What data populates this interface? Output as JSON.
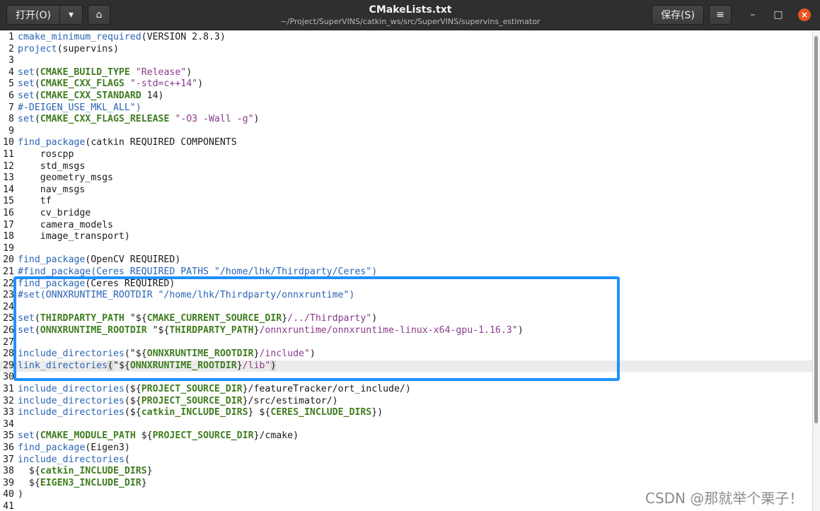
{
  "toolbar": {
    "open_label": "打开(O)",
    "open_menu_icon": "▾",
    "pin_icon": "⌂",
    "save_label": "保存(S)",
    "menu_icon": "≡",
    "minimize_icon": "–",
    "maximize_icon": "□",
    "close_icon": "×"
  },
  "window": {
    "title": "CMakeLists.txt",
    "path": "~/Project/SuperVINS/catkin_ws/src/SuperVINS/supervins_estimator"
  },
  "editor": {
    "current_line": 29,
    "lines": [
      {
        "n": "1",
        "html": "<span class=\"kw\">cmake_minimum_required</span>(VERSION 2.8.3)"
      },
      {
        "n": "2",
        "html": "<span class=\"kw\">project</span>(supervins)"
      },
      {
        "n": "3",
        "html": ""
      },
      {
        "n": "4",
        "html": "<span class=\"kw\">set</span>(<span class=\"var\">CMAKE_BUILD_TYPE</span> <span class=\"str\">\"Release\"</span>)"
      },
      {
        "n": "5",
        "html": "<span class=\"kw\">set</span>(<span class=\"var\">CMAKE_CXX_FLAGS</span> <span class=\"str\">\"-std=c++14\"</span>)"
      },
      {
        "n": "6",
        "html": "<span class=\"kw\">set</span>(<span class=\"var\">CMAKE_CXX_STANDARD</span> 14)"
      },
      {
        "n": "7",
        "html": "<span class=\"cm\">#-DEIGEN_USE_MKL_ALL\")</span>"
      },
      {
        "n": "8",
        "html": "<span class=\"kw\">set</span>(<span class=\"var\">CMAKE_CXX_FLAGS_RELEASE</span> <span class=\"str\">\"-O3 -Wall -g\"</span>)"
      },
      {
        "n": "9",
        "html": ""
      },
      {
        "n": "10",
        "html": "<span class=\"kw\">find_package</span>(catkin REQUIRED COMPONENTS"
      },
      {
        "n": "11",
        "html": "    roscpp"
      },
      {
        "n": "12",
        "html": "    std_msgs"
      },
      {
        "n": "13",
        "html": "    geometry_msgs"
      },
      {
        "n": "14",
        "html": "    nav_msgs"
      },
      {
        "n": "15",
        "html": "    tf"
      },
      {
        "n": "16",
        "html": "    cv_bridge"
      },
      {
        "n": "17",
        "html": "    camera_models"
      },
      {
        "n": "18",
        "html": "    image_transport)"
      },
      {
        "n": "19",
        "html": ""
      },
      {
        "n": "20",
        "html": "<span class=\"kw\">find_package</span>(OpenCV REQUIRED)"
      },
      {
        "n": "21",
        "html": "<span class=\"cm\">#find_package(Ceres REQUIRED PATHS \"/home/lhk/Thirdparty/Ceres\")</span>"
      },
      {
        "n": "22",
        "html": "<span class=\"kw\">find_package</span>(Ceres REQUIRED)"
      },
      {
        "n": "23",
        "html": "<span class=\"cm\">#set(ONNXRUNTIME_ROOTDIR \"/home/lhk/Thirdparty/onnxruntime\")</span>"
      },
      {
        "n": "24",
        "html": ""
      },
      {
        "n": "25",
        "html": "<span class=\"kw\">set</span>(<span class=\"var\">THIRDPARTY_PATH</span> \"${<span class=\"var\">CMAKE_CURRENT_SOURCE_DIR</span>}<span class=\"str\">/../Thirdparty\"</span>)"
      },
      {
        "n": "26",
        "html": "<span class=\"kw\">set</span>(<span class=\"var\">ONNXRUNTIME_ROOTDIR</span> \"${<span class=\"var\">THIRDPARTY_PATH</span>}<span class=\"str\">/onnxruntime/onnxruntime-linux-x64-gpu-1.16.3\"</span>)"
      },
      {
        "n": "27",
        "html": ""
      },
      {
        "n": "28",
        "html": "<span class=\"kw\">include_directories</span>(\"${<span class=\"var\">ONNXRUNTIME_ROOTDIR</span>}<span class=\"str\">/include\"</span>)"
      },
      {
        "n": "29",
        "html": "<span class=\"kw\">link_directories</span><span class=\"sel\">(</span>\"${<span class=\"var\">ONNXRUNTIME_ROOTDIR</span>}<span class=\"str\">/lib\"</span><span class=\"sel\">)</span>"
      },
      {
        "n": "30",
        "html": ""
      },
      {
        "n": "31",
        "html": "<span class=\"kw\">include_directories</span>(${<span class=\"var\">PROJECT_SOURCE_DIR</span>}/featureTracker/ort_include/)"
      },
      {
        "n": "32",
        "html": "<span class=\"kw\">include_directories</span>(${<span class=\"var\">PROJECT_SOURCE_DIR</span>}/src/estimator/)"
      },
      {
        "n": "33",
        "html": "<span class=\"kw\">include_directories</span>(${<span class=\"var\">catkin_INCLUDE_DIRS</span>} ${<span class=\"var\">CERES_INCLUDE_DIRS</span>})"
      },
      {
        "n": "34",
        "html": ""
      },
      {
        "n": "35",
        "html": "<span class=\"kw\">set</span>(<span class=\"var\">CMAKE_MODULE_PATH</span> ${<span class=\"var\">PROJECT_SOURCE_DIR</span>}/cmake)"
      },
      {
        "n": "36",
        "html": "<span class=\"kw\">find_package</span>(Eigen3)"
      },
      {
        "n": "37",
        "html": "<span class=\"kw\">include_directories</span>("
      },
      {
        "n": "38",
        "html": "  ${<span class=\"var\">catkin_INCLUDE_DIRS</span>}"
      },
      {
        "n": "39",
        "html": "  ${<span class=\"var\">EIGEN3_INCLUDE_DIR</span>}"
      },
      {
        "n": "40",
        "html": ")"
      },
      {
        "n": "41",
        "html": ""
      }
    ]
  },
  "watermark": "CSDN @那就举个栗子！",
  "colors": {
    "keyword": "#2a64b5",
    "variable": "#3f7d1f",
    "string": "#8a3a8a",
    "highlight_box": "#1e90ff",
    "close_button": "#e95420"
  }
}
